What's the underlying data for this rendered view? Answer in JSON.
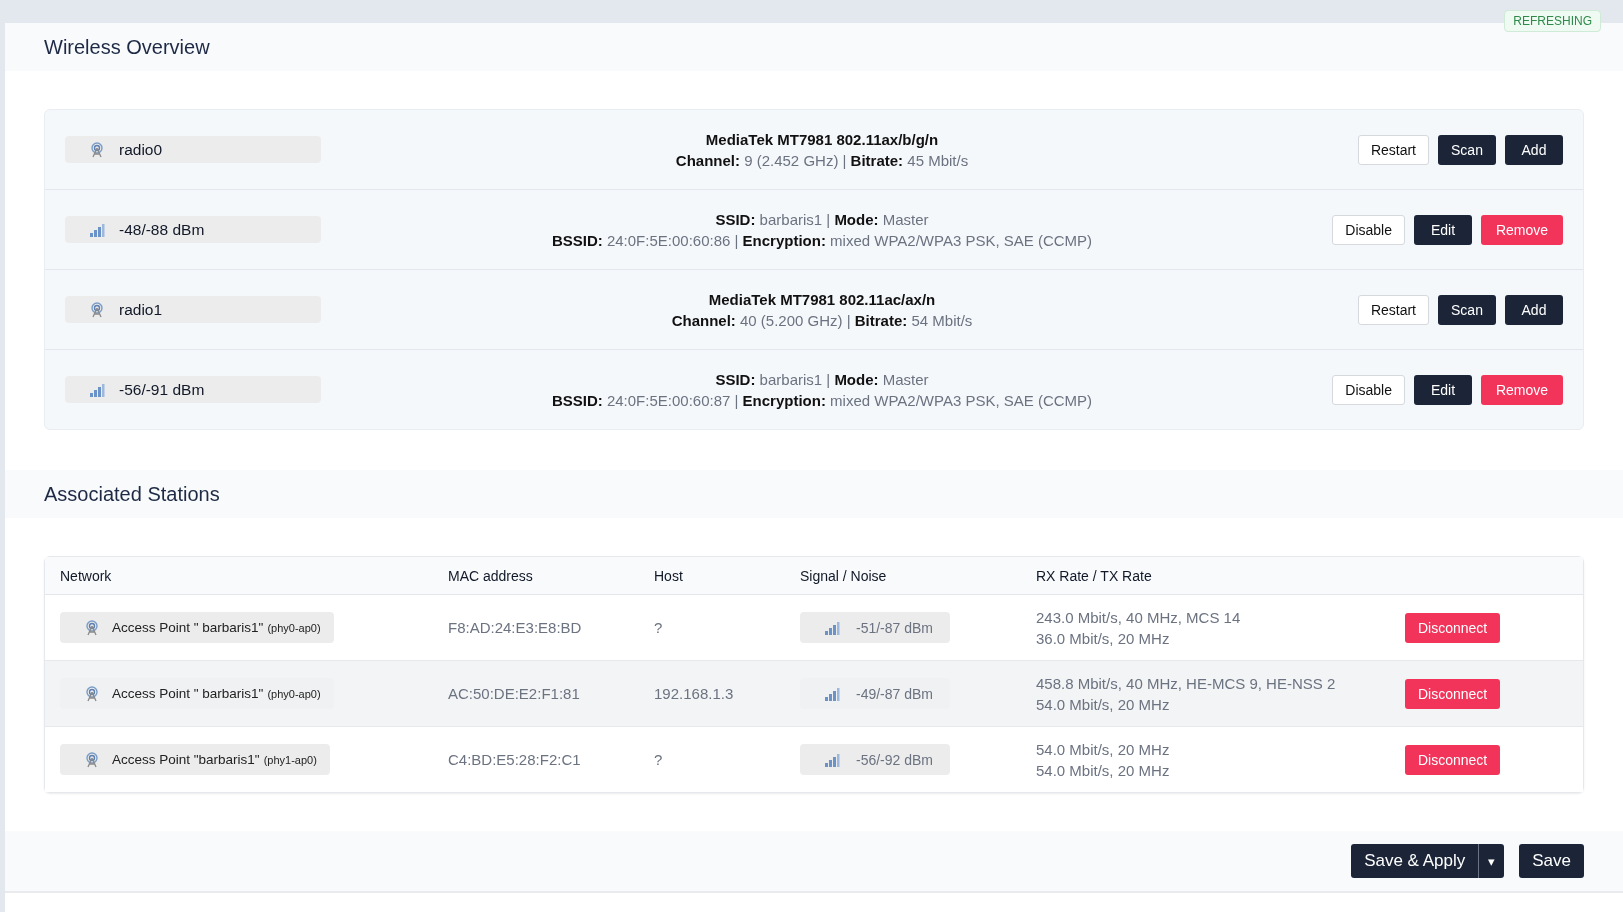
{
  "status_badge": "REFRESHING",
  "wireless_overview": {
    "title": "Wireless Overview",
    "rows": [
      {
        "kind": "radio",
        "badge": "radio0",
        "lines": [
          "**MediaTek MT7981 802.11ax/b/g/n**",
          "**Channel:** 9 (2.452 GHz) | **Bitrate:** 45 Mbit/s"
        ],
        "buttons": [
          {
            "label": "Restart",
            "kind": "outline"
          },
          {
            "label": "Scan",
            "kind": "dark"
          },
          {
            "label": "Add",
            "kind": "dark"
          }
        ]
      },
      {
        "kind": "network",
        "badge": "-48/-88 dBm",
        "lines": [
          "**SSID:** barbaris1 | **Mode:** Master",
          "**BSSID:** 24:0F:5E:00:60:86 | **Encryption:** mixed WPA2/WPA3 PSK, SAE (CCMP)"
        ],
        "buttons": [
          {
            "label": "Disable",
            "kind": "outline"
          },
          {
            "label": "Edit",
            "kind": "dark"
          },
          {
            "label": "Remove",
            "kind": "danger"
          }
        ]
      },
      {
        "kind": "radio",
        "badge": "radio1",
        "lines": [
          "**MediaTek MT7981 802.11ac/ax/n**",
          "**Channel:** 40 (5.200 GHz) | **Bitrate:** 54 Mbit/s"
        ],
        "buttons": [
          {
            "label": "Restart",
            "kind": "outline"
          },
          {
            "label": "Scan",
            "kind": "dark"
          },
          {
            "label": "Add",
            "kind": "dark"
          }
        ]
      },
      {
        "kind": "network",
        "badge": "-56/-91 dBm",
        "lines": [
          "**SSID:** barbaris1 | **Mode:** Master",
          "**BSSID:** 24:0F:5E:00:60:87 | **Encryption:** mixed WPA2/WPA3 PSK, SAE (CCMP)"
        ],
        "buttons": [
          {
            "label": "Disable",
            "kind": "outline"
          },
          {
            "label": "Edit",
            "kind": "dark"
          },
          {
            "label": "Remove",
            "kind": "danger"
          }
        ]
      }
    ]
  },
  "associated_stations": {
    "title": "Associated Stations",
    "columns": [
      "Network",
      "MAC address",
      "Host",
      "Signal / Noise",
      "RX Rate / TX Rate"
    ],
    "rows": [
      {
        "selected": false,
        "network": "Access Point \" barbaris1\"",
        "interface": "(phy0-ap0)",
        "mac": "F8:AD:24:E3:E8:BD",
        "host": "?",
        "signal": "-51/-87 dBm",
        "rx": "243.0 Mbit/s, 40 MHz, MCS 14",
        "tx": "36.0 Mbit/s, 20 MHz",
        "button": "Disconnect"
      },
      {
        "selected": true,
        "network": "Access Point \" barbaris1\"",
        "interface": "(phy0-ap0)",
        "mac": "AC:50:DE:E2:F1:81",
        "host": "192.168.1.3",
        "signal": "-49/-87 dBm",
        "rx": "458.8 Mbit/s, 40 MHz, HE-MCS 9, HE-NSS 2",
        "tx": "54.0 Mbit/s, 20 MHz",
        "button": "Disconnect"
      },
      {
        "selected": false,
        "network": "Access Point \"barbaris1\"",
        "interface": "(phy1-ap0)",
        "mac": "C4:BD:E5:28:F2:C1",
        "host": "?",
        "signal": "-56/-92 dBm",
        "rx": "54.0 Mbit/s, 20 MHz",
        "tx": "54.0 Mbit/s, 20 MHz",
        "button": "Disconnect"
      }
    ]
  },
  "footer": {
    "save_apply": "Save & Apply",
    "dropdown": "▾",
    "save": "Save"
  }
}
